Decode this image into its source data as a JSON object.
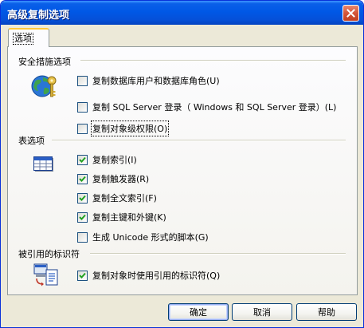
{
  "window": {
    "title": "高级复制选项"
  },
  "tab": {
    "label": "选项"
  },
  "security": {
    "heading": "安全措施选项",
    "items": [
      {
        "label": "复制数据库用户和数据库角色(U)",
        "checked": false
      },
      {
        "label": "复制 SQL Server 登录（ Windows 和 SQL Server 登录）(L)",
        "checked": false
      },
      {
        "label": "复制对象级权限(O)",
        "checked": false
      }
    ]
  },
  "table": {
    "heading": "表选项",
    "items": [
      {
        "label": "复制索引(I)",
        "checked": true
      },
      {
        "label": "复制触发器(R)",
        "checked": true
      },
      {
        "label": "复制全文索引(F)",
        "checked": true
      },
      {
        "label": "复制主键和外键(K)",
        "checked": true
      },
      {
        "label": "生成 Unicode 形式的脚本(G)",
        "checked": false
      }
    ]
  },
  "quoted": {
    "heading": "被引用的标识符",
    "items": [
      {
        "label": "复制对象时使用引用的标识符(Q)",
        "checked": true
      }
    ]
  },
  "buttons": {
    "ok": "确定",
    "cancel": "取消",
    "help": "帮助"
  },
  "icons": {
    "security": "globe-key-icon",
    "table": "table-grid-icon",
    "quoted": "document-copy-icon",
    "close": "close-icon"
  }
}
